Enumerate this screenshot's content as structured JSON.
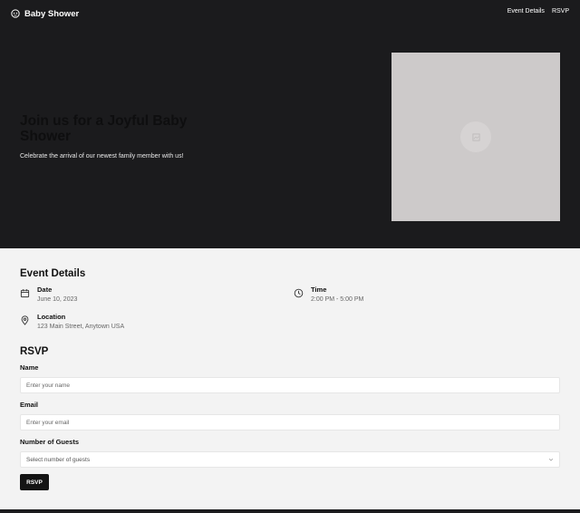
{
  "nav": {
    "brand": "Baby Shower",
    "links": [
      "Event Details",
      "RSVP"
    ]
  },
  "hero": {
    "title": "Join us for a Joyful Baby Shower",
    "subtitle": "Celebrate the arrival of our newest family member with us!"
  },
  "event": {
    "heading": "Event Details",
    "date": {
      "label": "Date",
      "value": "June 10, 2023",
      "icon": "calendar-icon"
    },
    "time": {
      "label": "Time",
      "value": "2:00 PM - 5:00 PM",
      "icon": "clock-icon"
    },
    "location": {
      "label": "Location",
      "value": "123 Main Street, Anytown USA",
      "icon": "map-pin-icon"
    }
  },
  "rsvp": {
    "heading": "RSVP",
    "name": {
      "label": "Name",
      "placeholder": "Enter your name"
    },
    "email": {
      "label": "Email",
      "placeholder": "Enter your email"
    },
    "guests": {
      "label": "Number of Guests",
      "placeholder": "Select number of guests"
    },
    "submit": "RSVP"
  },
  "colors": {
    "hero_bg": "#1b1b1d",
    "page_bg": "#f3f3f3",
    "image_placeholder": "#cdcaca",
    "button": "#141414"
  }
}
